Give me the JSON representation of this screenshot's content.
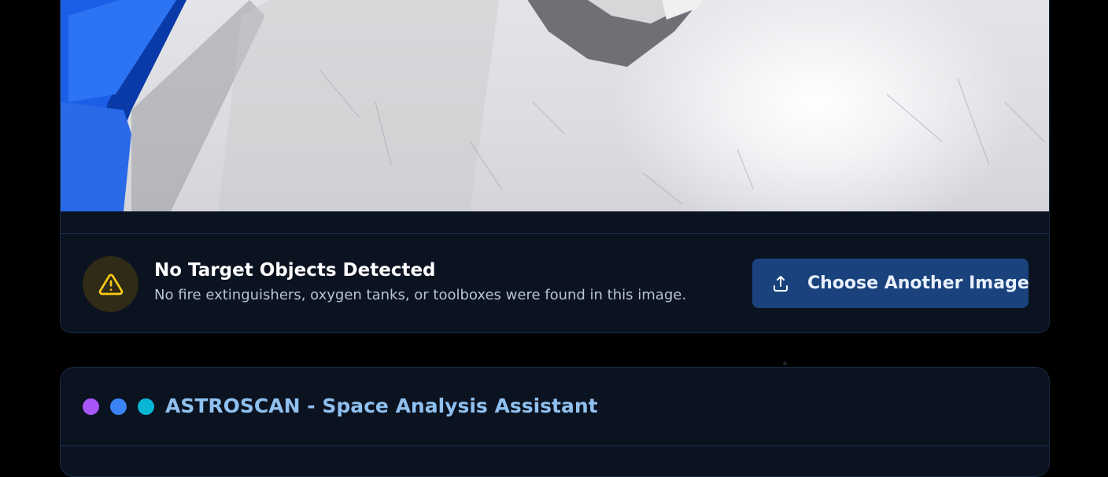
{
  "result": {
    "status_title": "No Target Objects Detected",
    "status_description": "No fire extinguishers, oxygen tanks, or toolboxes were found in this image.",
    "status_icon": "warning-triangle-icon",
    "choose_button_label": "Choose Another Image",
    "choose_button_icon": "upload-icon"
  },
  "assistant": {
    "title": "ASTROSCAN - Space Analysis Assistant",
    "dots": [
      "#a855f7",
      "#3b82f6",
      "#06b6d4"
    ]
  },
  "colors": {
    "background": "#000000",
    "card": "#0b1220",
    "button": "#1a427c",
    "warning": "#facc15",
    "title_accent": "#8fc0ef"
  }
}
